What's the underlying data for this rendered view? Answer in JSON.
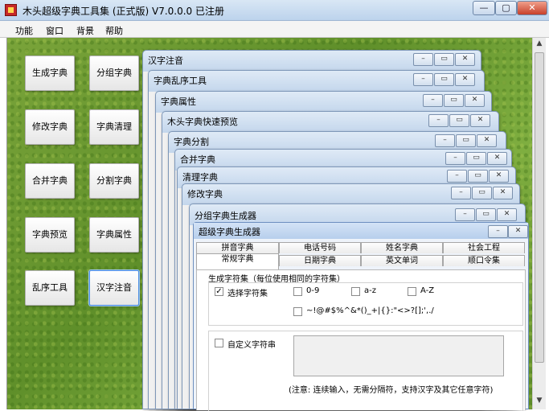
{
  "app": {
    "title": "木头超级字典工具集 (正式版) V7.0.0.0 已注册"
  },
  "caption_buttons": {
    "minimize": "—",
    "maximize": "▢",
    "close": "✕"
  },
  "menu": [
    "功能",
    "窗口",
    "背景",
    "帮助"
  ],
  "tools": [
    "生成字典",
    "分组字典",
    "修改字典",
    "字典清理",
    "合并字典",
    "分割字典",
    "字典预览",
    "字典属性",
    "乱序工具",
    "汉字注音"
  ],
  "child_windows": [
    "汉字注音",
    "字典乱序工具",
    "字典属性",
    "木头字典快速预览",
    "字典分割",
    "合并字典",
    "清理字典",
    "修改字典",
    "分组字典生成器"
  ],
  "mdi_buttons": {
    "minimize": "–",
    "restore": "▭",
    "close": "✕"
  },
  "generator": {
    "title": "超级字典生成器",
    "tabs_back": [
      "拼音字典",
      "电话号码",
      "姓名字典",
      "社会工程"
    ],
    "tabs_front": [
      "常规字典",
      "日期字典",
      "英文单词",
      "顺口令集"
    ],
    "group_title": "生成字符集（每位使用相同的字符集）",
    "select_charset": "选择字符集",
    "opt_digits": "0-9",
    "opt_lower": "a-z",
    "opt_upper": "A-Z",
    "opt_symbols": "~!@#$%^&*()_+|{}:\"<>?[];',./",
    "custom_label": "自定义字符串",
    "note": "(注意: 连续输入，无需分隔符，支持汉字及其它任意字符)",
    "check_mark": "✓"
  }
}
